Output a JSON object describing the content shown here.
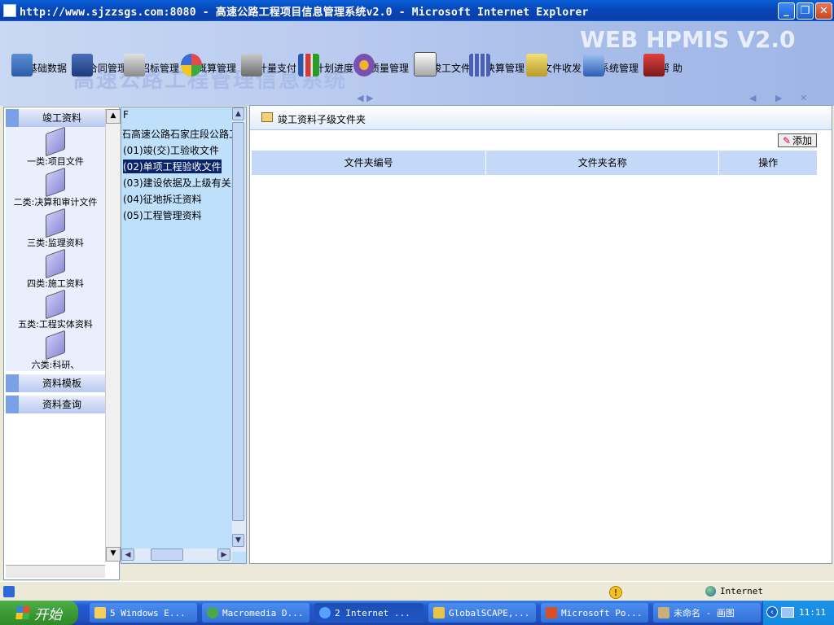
{
  "window": {
    "title": "http://www.sjzzsgs.com:8080 - 高速公路工程项目信息管理系统v2.0 - Microsoft Internet Explorer"
  },
  "banner": {
    "brand": "WEB HPMIS V2.0",
    "subtitle": "高速公路工程管理信息系统"
  },
  "toolbar": {
    "items": [
      {
        "label": "基础数据",
        "icon": "database-icon"
      },
      {
        "label": "合同管理",
        "icon": "contract-icon"
      },
      {
        "label": "招标管理",
        "icon": "bidding-icon"
      },
      {
        "label": "概算管理",
        "icon": "estimate-pie-icon"
      },
      {
        "label": "计量支付",
        "icon": "payment-icon"
      },
      {
        "label": "计划进度",
        "icon": "schedule-chart-icon"
      },
      {
        "label": "质量管理",
        "icon": "quality-gear-icon"
      },
      {
        "label": "竣工文件",
        "icon": "completion-docs-icon"
      },
      {
        "label": "决算管理",
        "icon": "settlement-grid-icon"
      },
      {
        "label": "文件收发",
        "icon": "mail-docs-icon"
      },
      {
        "label": "系统管理",
        "icon": "system-computer-icon"
      },
      {
        "label": "帮 助",
        "icon": "help-icon"
      }
    ]
  },
  "left_panel": {
    "section_top": "竣工资料",
    "items": [
      "一类:项目文件",
      "二类:决算和审计文件",
      "三类:监理资料",
      "四类:施工资料",
      "五类:工程实体资料",
      "六类:科研、"
    ],
    "section_templates": "资料模板",
    "section_query": "资料查询"
  },
  "tree": {
    "header_fragment": "F",
    "root": "石高速公路石家庄段公路工",
    "items": [
      "(01)竣(交)工验收文件",
      "(02)单项工程验收文件",
      "(03)建设依据及上级有关",
      "(04)征地拆迁资料",
      "(05)工程管理资料"
    ],
    "selected_index": 1
  },
  "main": {
    "title": "竣工资料子级文件夹",
    "add_label": "添加",
    "columns": [
      "文件夹编号",
      "文件夹名称",
      "操作"
    ]
  },
  "statusbar": {
    "zone": "Internet"
  },
  "taskbar": {
    "start_label": "开始",
    "tasks": [
      "5 Windows E...",
      "Macromedia D...",
      "2 Internet ...",
      "GlobalSCAPE,...",
      "Microsoft Po...",
      "未命名 - 画图"
    ],
    "clock": "11:11"
  }
}
